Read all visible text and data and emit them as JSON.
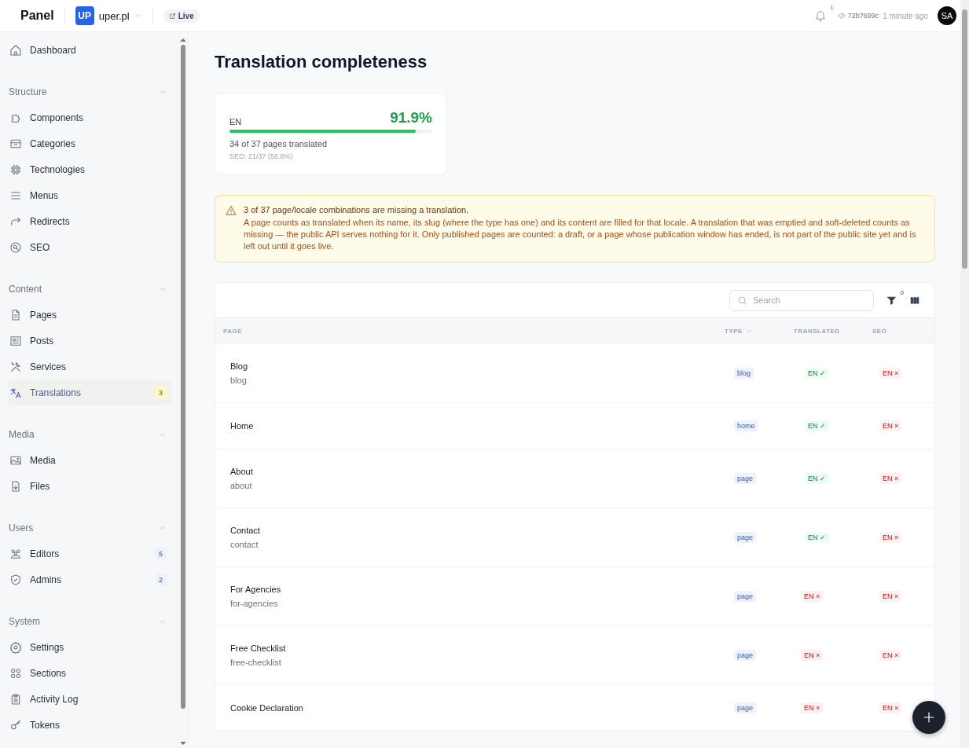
{
  "topbar": {
    "brand": "Panel",
    "workspace": {
      "initials": "UP",
      "name": "uper.pl"
    },
    "live": "Live",
    "notifications": "1",
    "commit": "72b7699c",
    "time": "1 minute ago",
    "user": "SA"
  },
  "sidebar": {
    "top": [
      {
        "label": "Dashboard",
        "selected": false
      }
    ],
    "sections": [
      {
        "title": "Structure",
        "expanded": true,
        "items": [
          {
            "label": "Components",
            "selected": false
          },
          {
            "label": "Categories",
            "selected": false
          },
          {
            "label": "Technologies",
            "selected": false
          },
          {
            "label": "Menus",
            "selected": false
          },
          {
            "label": "Redirects",
            "selected": false
          },
          {
            "label": "SEO",
            "selected": false
          }
        ]
      },
      {
        "title": "Content",
        "expanded": true,
        "items": [
          {
            "label": "Pages",
            "selected": false
          },
          {
            "label": "Posts",
            "selected": false
          },
          {
            "label": "Services",
            "selected": false
          },
          {
            "label": "Translations",
            "selected": true,
            "badge": {
              "text": "3",
              "color": "#fef9c3"
            }
          }
        ]
      },
      {
        "title": "Media",
        "expanded": true,
        "items": [
          {
            "label": "Media",
            "selected": false
          },
          {
            "label": "Files",
            "selected": false
          }
        ]
      },
      {
        "title": "Users",
        "expanded": true,
        "items": [
          {
            "label": "Editors",
            "selected": false,
            "badge": {
              "text": "5",
              "color": "#eef2ff"
            }
          },
          {
            "label": "Admins",
            "selected": false,
            "badge": {
              "text": "2",
              "color": "#eef2ff"
            }
          }
        ]
      },
      {
        "title": "System",
        "expanded": true,
        "items": [
          {
            "label": "Settings",
            "selected": false
          },
          {
            "label": "Sections",
            "selected": false
          },
          {
            "label": "Activity Log",
            "selected": false
          },
          {
            "label": "Tokens",
            "selected": false
          }
        ]
      }
    ]
  },
  "page": {
    "title": "Translation completeness",
    "locale_card": {
      "locale": "EN",
      "percent": "91.9%",
      "level": 0.919,
      "summary": "34 of 37 pages translated",
      "seo": "SEO: 21/37 (56.8%)"
    },
    "alert": {
      "title": "3 of 37 page/locale combinations are missing a translation.",
      "body": "A page counts as translated when its name, its slug (where the type has one) and its content are filled for that locale. A translation that was emptied and soft-deleted counts as missing — the public API serves nothing for it. Only published pages are counted: a draft, or a page whose publication window has ended, is not part of the public site yet and is left out until it goes live."
    },
    "table": {
      "search": {
        "placeholder": "Search"
      },
      "filter_count": "0",
      "columns": [
        {
          "label": "PAGE",
          "sortable": false
        },
        {
          "label": "TYPE",
          "sortable": true
        },
        {
          "label": "TRANSLATED",
          "sortable": false
        },
        {
          "label": "SEO",
          "sortable": false
        }
      ],
      "rows": [
        {
          "name": "Blog",
          "slug": "blog",
          "type": "blog",
          "translated": {
            "text": "EN ✓",
            "ok": true
          },
          "seo": {
            "text": "EN ×",
            "ok": false
          }
        },
        {
          "name": "Home",
          "type": "home",
          "translated": {
            "text": "EN ✓",
            "ok": true
          },
          "seo": {
            "text": "EN ×",
            "ok": false
          }
        },
        {
          "name": "About",
          "slug": "about",
          "type": "page",
          "translated": {
            "text": "EN ✓",
            "ok": true
          },
          "seo": {
            "text": "EN ×",
            "ok": false
          }
        },
        {
          "name": "Contact",
          "slug": "contact",
          "type": "page",
          "translated": {
            "text": "EN ✓",
            "ok": true
          },
          "seo": {
            "text": "EN ×",
            "ok": false
          }
        },
        {
          "name": "For Agencies",
          "slug": "for-agencies",
          "type": "page",
          "translated": {
            "text": "EN ×",
            "ok": false
          },
          "seo": {
            "text": "EN ×",
            "ok": false
          }
        },
        {
          "name": "Free Checklist",
          "slug": "free-checklist",
          "type": "page",
          "translated": {
            "text": "EN ×",
            "ok": false
          },
          "seo": {
            "text": "EN ×",
            "ok": false
          }
        },
        {
          "name": "Cookie Declaration",
          "type": "page",
          "translated": {
            "text": "EN ×",
            "ok": false
          },
          "seo": {
            "text": "EN ×",
            "ok": false
          }
        }
      ]
    }
  }
}
